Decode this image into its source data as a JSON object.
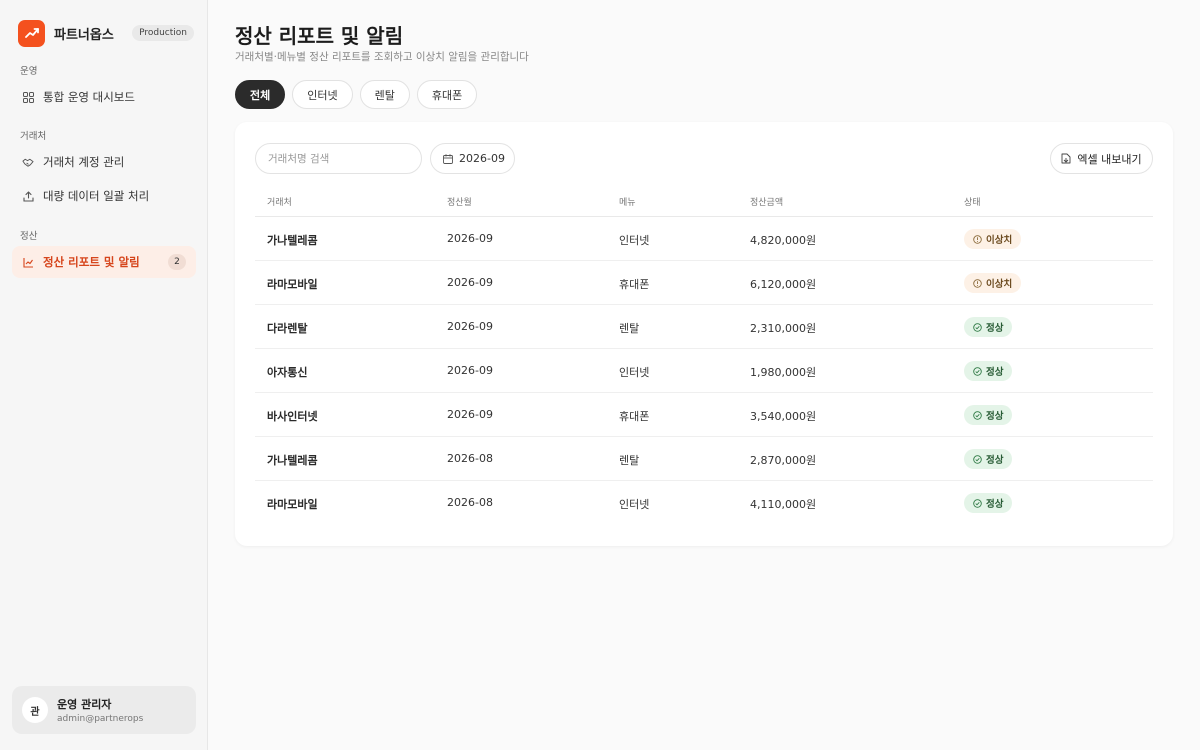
{
  "brand": {
    "name": "파트너옵스",
    "env": "Production"
  },
  "sidebar": {
    "sections": [
      {
        "label": "운영",
        "items": [
          {
            "label": "통합 운영 대시보드",
            "icon": "grid-icon"
          }
        ]
      },
      {
        "label": "거래처",
        "items": [
          {
            "label": "거래처 계정 관리",
            "icon": "handshake-icon"
          },
          {
            "label": "대량 데이터 일괄 처리",
            "icon": "upload-icon"
          }
        ]
      },
      {
        "label": "정산",
        "items": [
          {
            "label": "정산 리포트 및 알림",
            "icon": "chart-line-icon",
            "active": true,
            "count": "2"
          }
        ]
      }
    ]
  },
  "user": {
    "avatar": "관",
    "name": "운영 관리자",
    "email": "admin@partnerops"
  },
  "page": {
    "title": "정산 리포트 및 알림",
    "subtitle": "거래처별·메뉴별 정산 리포트를 조회하고 이상치 알림을 관리합니다"
  },
  "tabs": [
    {
      "label": "전체",
      "active": true
    },
    {
      "label": "인터넷"
    },
    {
      "label": "렌탈"
    },
    {
      "label": "휴대폰"
    }
  ],
  "filters": {
    "search_placeholder": "거래처명 검색",
    "month": "2026-09",
    "export_label": "엑셀 내보내기"
  },
  "table": {
    "columns": [
      "거래처",
      "정산월",
      "메뉴",
      "정산금액",
      "상태"
    ],
    "rows": [
      {
        "vendor": "가나텔레콤",
        "month": "2026-09",
        "menu": "인터넷",
        "amount": "4,820,000원",
        "status": "이상치",
        "status_type": "warn"
      },
      {
        "vendor": "라마모바일",
        "month": "2026-09",
        "menu": "휴대폰",
        "amount": "6,120,000원",
        "status": "이상치",
        "status_type": "warn"
      },
      {
        "vendor": "다라렌탈",
        "month": "2026-09",
        "menu": "렌탈",
        "amount": "2,310,000원",
        "status": "정상",
        "status_type": "ok"
      },
      {
        "vendor": "아자통신",
        "month": "2026-09",
        "menu": "인터넷",
        "amount": "1,980,000원",
        "status": "정상",
        "status_type": "ok"
      },
      {
        "vendor": "바사인터넷",
        "month": "2026-09",
        "menu": "휴대폰",
        "amount": "3,540,000원",
        "status": "정상",
        "status_type": "ok"
      },
      {
        "vendor": "가나텔레콤",
        "month": "2026-08",
        "menu": "렌탈",
        "amount": "2,870,000원",
        "status": "정상",
        "status_type": "ok"
      },
      {
        "vendor": "라마모바일",
        "month": "2026-08",
        "menu": "인터넷",
        "amount": "4,110,000원",
        "status": "정상",
        "status_type": "ok"
      }
    ]
  },
  "colors": {
    "accent": "#f4511e",
    "active_nav_bg": "#fdeee7",
    "active_nav_text": "#d6451c",
    "warn_bg": "#fdf1e6",
    "ok_bg": "#e4f4e8"
  }
}
